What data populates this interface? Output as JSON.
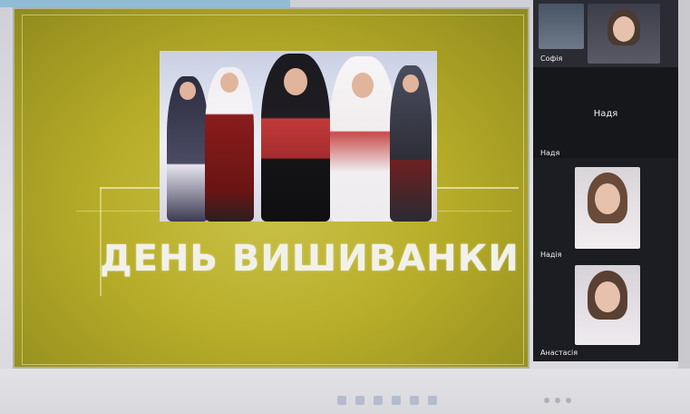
{
  "slide": {
    "title": "ДЕНЬ ВИШИВАНКИ"
  },
  "participants": [
    {
      "name": "Софія",
      "video": true
    },
    {
      "name": "Надя",
      "video": false,
      "center_label": "Надя"
    },
    {
      "name": "Надя",
      "video": false
    },
    {
      "name": "Надія",
      "video": true
    },
    {
      "name": "Анастасія",
      "video": true
    }
  ],
  "taskbar": {
    "left_text": "",
    "icons": [
      "start-icon",
      "search-icon",
      "browser-icon",
      "folder-icon",
      "meeting-icon",
      "mail-icon"
    ]
  },
  "colors": {
    "slide_bg": "#b9ae2a",
    "panel_bg": "#1c1d22",
    "title_text": "#f1f1ea"
  }
}
